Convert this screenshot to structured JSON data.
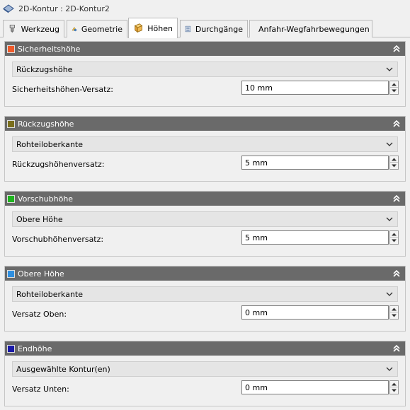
{
  "window": {
    "title": "2D-Kontur : 2D-Kontur2",
    "title_icon": "contour-icon"
  },
  "tabs": [
    {
      "label": "Werkzeug",
      "icon": "tool-icon",
      "active": false
    },
    {
      "label": "Geometrie",
      "icon": "geometry-icon",
      "active": false
    },
    {
      "label": "Höhen",
      "icon": "heights-icon",
      "active": true
    },
    {
      "label": "Durchgänge",
      "icon": "passes-icon",
      "active": false
    },
    {
      "label": "Anfahr-Wegfahrbewegungen",
      "icon": "linking-icon",
      "active": false
    }
  ],
  "panels": [
    {
      "title": "Sicherheitshöhe",
      "color": "#ef5a2a",
      "dropdown": "Rückzugshöhe",
      "field_label": "Sicherheitshöhen-Versatz:",
      "value": "10 mm"
    },
    {
      "title": "Rückzugshöhe",
      "color": "#7a6e1c",
      "dropdown": "Rohteiloberkante",
      "field_label": "Rückzugshöhenversatz:",
      "value": "5 mm"
    },
    {
      "title": "Vorschubhöhe",
      "color": "#1fb41f",
      "dropdown": "Obere Höhe",
      "field_label": "Vorschubhöhenversatz:",
      "value": "5 mm"
    },
    {
      "title": "Obere Höhe",
      "color": "#2f8fe0",
      "dropdown": "Rohteiloberkante",
      "field_label": "Versatz Oben:",
      "value": "0 mm"
    },
    {
      "title": "Endhöhe",
      "color": "#1a1aa8",
      "dropdown": "Ausgewählte Kontur(en)",
      "field_label": "Versatz Unten:",
      "value": "0 mm"
    }
  ]
}
